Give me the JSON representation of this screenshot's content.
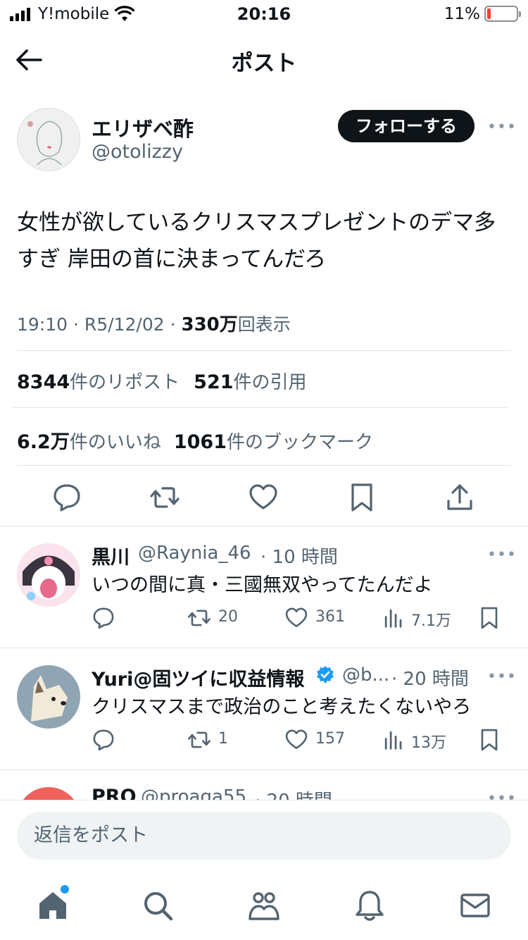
{
  "status_bar": {
    "carrier": "Y!mobile",
    "time": "20:16",
    "battery": "11%"
  },
  "header": {
    "title": "ポスト"
  },
  "post": {
    "author_name": "エリザベ酢",
    "author_handle": "@otolizzy",
    "follow_label": "フォローする",
    "text": "女性が欲しているクリスマスプレゼントのデマ多すぎ 岸田の首に決まってんだろ",
    "time": "19:10 · R5/12/02 · ",
    "views_count": "330万",
    "views_label": "回表示",
    "reposts_count": "8344",
    "reposts_label": "件のリポスト",
    "quotes_count": "521",
    "quotes_label": "件の引用",
    "likes_count": "6.2万",
    "likes_label": "件のいいね",
    "bookmarks_count": "1061",
    "bookmarks_label": "件のブックマーク"
  },
  "replies": [
    {
      "name": "黒川",
      "handle": "@Raynia_46",
      "time": "· 10 時間",
      "text": "いつの間に真・三國無双やってたんだよ",
      "reposts": "20",
      "likes": "361",
      "views": "7.1万"
    },
    {
      "name": "Yuri@固ツイに収益情報",
      "handle": "@b...",
      "time": "· 20 時間",
      "text": "クリスマスまで政治のこと考えたくないやろ",
      "reposts": "1",
      "likes": "157",
      "views": "13万"
    },
    {
      "name": "PRO",
      "handle": "@proaga55",
      "time": "· 20 時間"
    }
  ],
  "reply_input": {
    "placeholder": "返信をポスト"
  },
  "colors": {
    "accent": "#1d9bf0",
    "verified": "#1d9bf0",
    "battery_low": "#ff3b30"
  },
  "icons": [
    "back-arrow-icon",
    "reply-icon",
    "repost-icon",
    "like-icon",
    "bookmark-icon",
    "share-icon",
    "views-icon",
    "home-icon",
    "search-icon",
    "communities-icon",
    "notifications-icon",
    "messages-icon"
  ]
}
